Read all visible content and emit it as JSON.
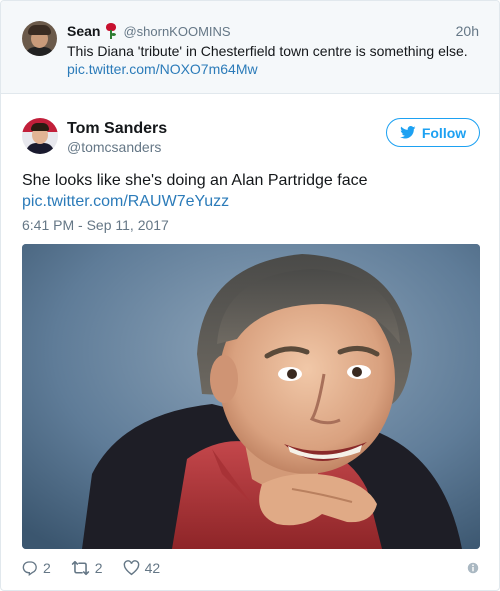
{
  "quoted_tweet": {
    "name": "Sean",
    "handle": "@shornKOOMINS",
    "time": "20h",
    "text": "This Diana 'tribute' in Chesterfield town centre is something else.",
    "link": "pic.twitter.com/NOXO7m64Mw"
  },
  "tweet": {
    "name": "Tom Sanders",
    "handle": "@tomcsanders",
    "follow_label": "Follow",
    "text": "She looks like she's doing an Alan Partridge face",
    "link": "pic.twitter.com/RAUW7eYuzz",
    "timestamp": "6:41 PM - Sep 11, 2017"
  },
  "actions": {
    "replies": "2",
    "retweets": "2",
    "likes": "42"
  },
  "icons": {
    "rose": "rose-emoji-icon",
    "bird": "twitter-bird-icon",
    "reply": "reply-icon",
    "retweet": "retweet-icon",
    "like": "heart-icon",
    "info": "info-icon"
  },
  "colors": {
    "accent": "#1da1f2",
    "link": "#2b7bb9",
    "muted": "#657786",
    "quoted_bg": "#f5f8fa"
  }
}
